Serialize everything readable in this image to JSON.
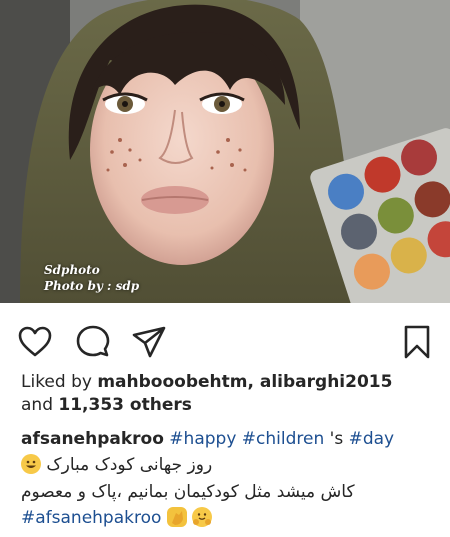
{
  "post": {
    "photo": {
      "description_icon": "portrait-photo",
      "watermark_line1": "Sdphoto",
      "watermark_line2": "Photo by : sdp"
    },
    "actions": {
      "like_icon": "heart-icon",
      "comment_icon": "comment-icon",
      "share_icon": "send-icon",
      "save_icon": "bookmark-icon"
    },
    "likes": {
      "prefix": "Liked by ",
      "user1": "mahbooobehtm",
      "separator": ", ",
      "user2": "alibarghi2015",
      "middle": "and ",
      "count": "11,353 others"
    },
    "caption": {
      "username": "afsanehpakroo",
      "tag1": "#happy",
      "tag2": "#children",
      "middle_text": " 's ",
      "tag3": "#day",
      "line2": "روز جهانی کودک مبارک",
      "line3": "کاش میشد مثل کودکیمان بمانیم ،پاک و معصوم",
      "tag4": "#afsanehpakroo"
    },
    "colors": {
      "hashtag": "#1d4f91",
      "text": "#262626"
    }
  }
}
